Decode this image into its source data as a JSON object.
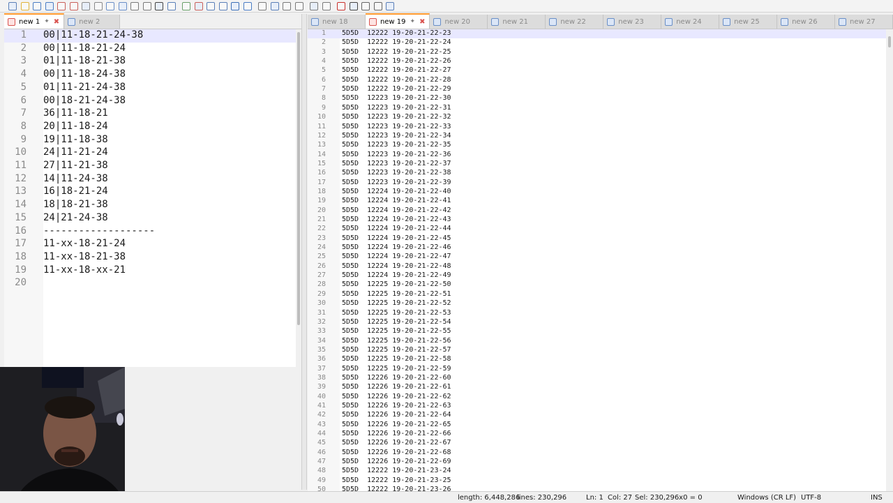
{
  "toolbar": {
    "icons": [
      "new-file-icon",
      "open-file-icon",
      "save-icon",
      "save-all-icon",
      "close-icon",
      "close-all-icon",
      "print-icon",
      "cut-icon",
      "copy-icon",
      "paste-icon",
      "undo-icon",
      "redo-icon",
      "find-icon",
      "replace-icon",
      "zoom-in-icon",
      "zoom-out-icon",
      "sync-vertical-icon",
      "sync-horizontal-icon",
      "word-wrap-icon",
      "show-all-chars-icon",
      "indent-guide-icon",
      "user-language-icon",
      "document-map-icon",
      "function-list-icon",
      "folder-workspace-icon",
      "monitoring-icon",
      "record-macro-icon",
      "stop-recording-icon",
      "play-macro-icon",
      "run-macro-multiple-icon",
      "save-macro-icon"
    ]
  },
  "left_tabs": [
    {
      "label": "new 1",
      "active": true
    },
    {
      "label": "new 2",
      "active": false
    }
  ],
  "right_tabs": [
    {
      "label": "new 18",
      "active": false
    },
    {
      "label": "new 19",
      "active": true
    },
    {
      "label": "new 20",
      "active": false
    },
    {
      "label": "new 21",
      "active": false
    },
    {
      "label": "new 22",
      "active": false
    },
    {
      "label": "new 23",
      "active": false
    },
    {
      "label": "new 24",
      "active": false
    },
    {
      "label": "new 25",
      "active": false
    },
    {
      "label": "new 26",
      "active": false
    },
    {
      "label": "new 27",
      "active": false
    }
  ],
  "left_editor": {
    "lines": [
      "00|11-18-21-24-38",
      "00|11-18-21-24",
      "01|11-18-21-38",
      "00|11-18-24-38",
      "01|11-21-24-38",
      "00|18-21-24-38",
      "36|11-18-21",
      "20|11-18-24",
      "19|11-18-38",
      "24|11-21-24",
      "27|11-21-38",
      "14|11-24-38",
      "16|18-21-24",
      "18|18-21-38",
      "24|21-24-38",
      "-------------------",
      "11-xx-18-21-24",
      "11-xx-18-21-38",
      "11-xx-18-xx-21",
      ""
    ]
  },
  "right_editor": {
    "lines": [
      "5D5D  12222 19-20-21-22-23",
      "5D5D  12222 19-20-21-22-24",
      "5D5D  12222 19-20-21-22-25",
      "5D5D  12222 19-20-21-22-26",
      "5D5D  12222 19-20-21-22-27",
      "5D5D  12222 19-20-21-22-28",
      "5D5D  12222 19-20-21-22-29",
      "5D5D  12223 19-20-21-22-30",
      "5D5D  12223 19-20-21-22-31",
      "5D5D  12223 19-20-21-22-32",
      "5D5D  12223 19-20-21-22-33",
      "5D5D  12223 19-20-21-22-34",
      "5D5D  12223 19-20-21-22-35",
      "5D5D  12223 19-20-21-22-36",
      "5D5D  12223 19-20-21-22-37",
      "5D5D  12223 19-20-21-22-38",
      "5D5D  12223 19-20-21-22-39",
      "5D5D  12224 19-20-21-22-40",
      "5D5D  12224 19-20-21-22-41",
      "5D5D  12224 19-20-21-22-42",
      "5D5D  12224 19-20-21-22-43",
      "5D5D  12224 19-20-21-22-44",
      "5D5D  12224 19-20-21-22-45",
      "5D5D  12224 19-20-21-22-46",
      "5D5D  12224 19-20-21-22-47",
      "5D5D  12224 19-20-21-22-48",
      "5D5D  12224 19-20-21-22-49",
      "5D5D  12225 19-20-21-22-50",
      "5D5D  12225 19-20-21-22-51",
      "5D5D  12225 19-20-21-22-52",
      "5D5D  12225 19-20-21-22-53",
      "5D5D  12225 19-20-21-22-54",
      "5D5D  12225 19-20-21-22-55",
      "5D5D  12225 19-20-21-22-56",
      "5D5D  12225 19-20-21-22-57",
      "5D5D  12225 19-20-21-22-58",
      "5D5D  12225 19-20-21-22-59",
      "5D5D  12226 19-20-21-22-60",
      "5D5D  12226 19-20-21-22-61",
      "5D5D  12226 19-20-21-22-62",
      "5D5D  12226 19-20-21-22-63",
      "5D5D  12226 19-20-21-22-64",
      "5D5D  12226 19-20-21-22-65",
      "5D5D  12226 19-20-21-22-66",
      "5D5D  12226 19-20-21-22-67",
      "5D5D  12226 19-20-21-22-68",
      "5D5D  12226 19-20-21-22-69",
      "5D5D  12222 19-20-21-23-24",
      "5D5D  12222 19-20-21-23-25",
      "5D5D  12222 19-20-21-23-26"
    ]
  },
  "status": {
    "length": "length: 6,448,286",
    "lines": "lines: 230,296",
    "ln": "Ln: 1",
    "col": "Col: 27",
    "sel": "Sel: 230,296x0 = 0",
    "eol": "Windows (CR LF)",
    "encoding": "UTF-8",
    "mode": "INS"
  },
  "colors": {
    "active_tab_accent": "#ff9a2e",
    "close_red": "#d9534f",
    "current_line": "#e8e8ff"
  }
}
